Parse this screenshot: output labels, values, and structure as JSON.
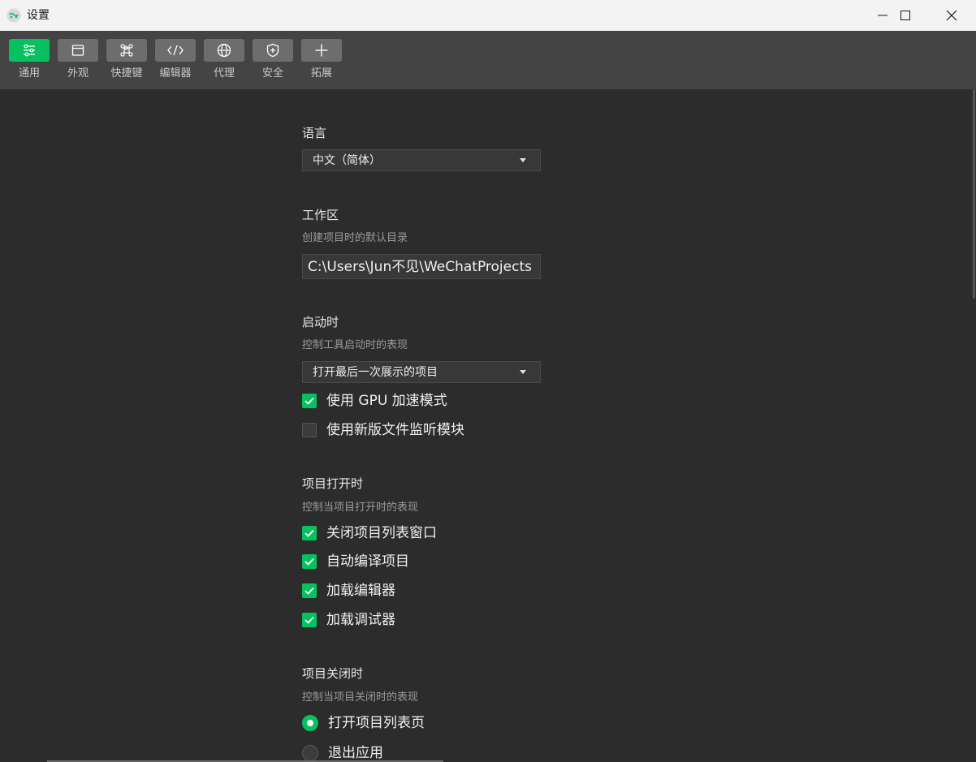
{
  "window": {
    "title": "设置"
  },
  "toolbar": {
    "items": [
      {
        "label": "通用",
        "icon": "general-settings-icon",
        "active": true
      },
      {
        "label": "外观",
        "icon": "appearance-icon",
        "active": false
      },
      {
        "label": "快捷键",
        "icon": "shortcut-command-icon",
        "active": false
      },
      {
        "label": "编辑器",
        "icon": "code-editor-icon",
        "active": false
      },
      {
        "label": "代理",
        "icon": "globe-proxy-icon",
        "active": false
      },
      {
        "label": "安全",
        "icon": "shield-icon",
        "active": false
      },
      {
        "label": "拓展",
        "icon": "plus-icon",
        "active": false
      }
    ]
  },
  "language": {
    "title": "语言",
    "value": "中文（简体）"
  },
  "workspace": {
    "title": "工作区",
    "desc": "创建项目时的默认目录",
    "path": "C:\\Users\\Jun不见\\WeChatProjects"
  },
  "startup": {
    "title": "启动时",
    "desc": "控制工具启动时的表现",
    "value": "打开最后一次展示的项目",
    "options": [
      {
        "label": "使用 GPU 加速模式",
        "checked": true
      },
      {
        "label": "使用新版文件监听模块",
        "checked": false
      }
    ]
  },
  "project_open": {
    "title": "项目打开时",
    "desc": "控制当项目打开时的表现",
    "options": [
      {
        "label": "关闭项目列表窗口",
        "checked": true
      },
      {
        "label": "自动编译项目",
        "checked": true
      },
      {
        "label": "加载编辑器",
        "checked": true
      },
      {
        "label": "加载调试器",
        "checked": true
      }
    ]
  },
  "project_close": {
    "title": "项目关闭时",
    "desc": "控制当项目关闭时的表现",
    "options": [
      {
        "label": "打开项目列表页",
        "selected": true
      },
      {
        "label": "退出应用",
        "selected": false
      }
    ]
  },
  "colors": {
    "accent": "#07c160",
    "background": "#2c2c2c",
    "toolbar": "#444444"
  }
}
